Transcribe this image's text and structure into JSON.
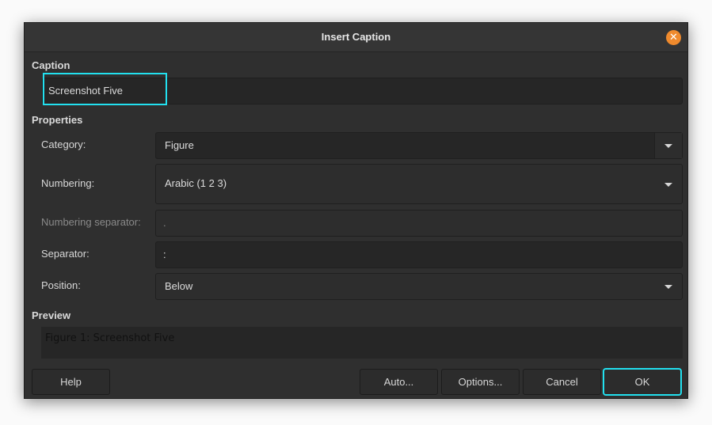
{
  "dialog": {
    "title": "Insert Caption",
    "close_icon": "close-icon"
  },
  "caption": {
    "heading": "Caption",
    "value": "Screenshot Five"
  },
  "properties": {
    "heading": "Properties",
    "category_label": "Category:",
    "category_value": "Figure",
    "numbering_label": "Numbering:",
    "numbering_value": "Arabic (1 2 3)",
    "numbering_separator_label": "Numbering separator:",
    "numbering_separator_value": ".",
    "separator_label": "Separator:",
    "separator_value": ":",
    "position_label": "Position:",
    "position_value": "Below"
  },
  "preview": {
    "heading": "Preview",
    "text": "Figure 1: Screenshot Five"
  },
  "buttons": {
    "help": "Help",
    "auto": "Auto...",
    "options": "Options...",
    "cancel": "Cancel",
    "ok": "OK"
  },
  "colors": {
    "focus": "#22e0ef",
    "close": "#ef8a2d"
  }
}
